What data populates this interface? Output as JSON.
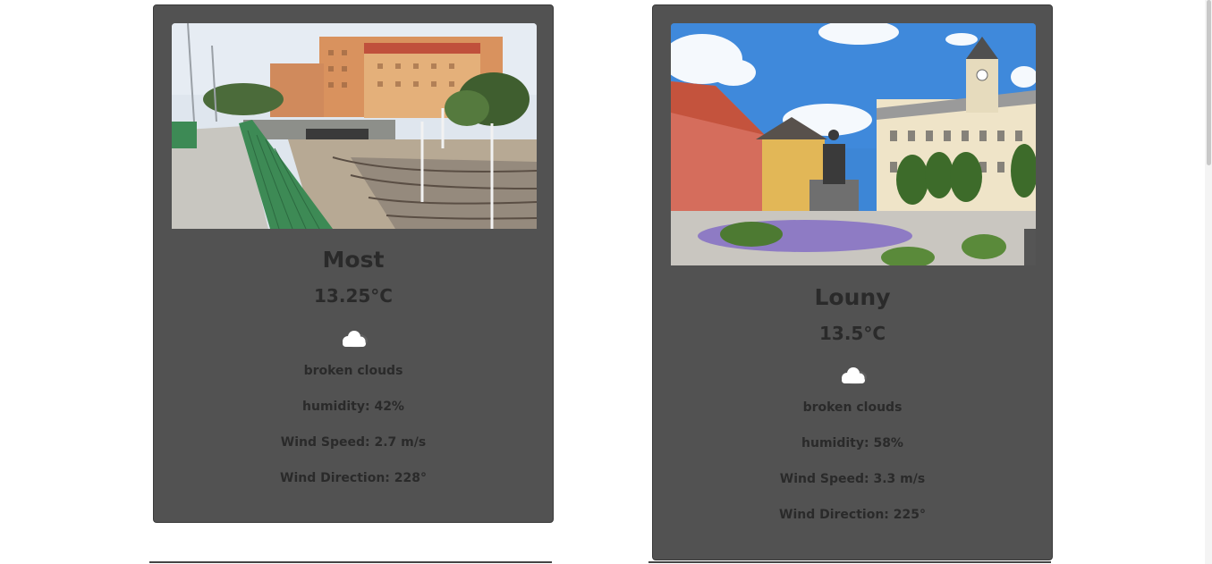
{
  "cards": [
    {
      "city": "Most",
      "temperature": "13.25°C",
      "weather_icon": "cloud-icon",
      "description": "broken clouds",
      "humidity": "humidity: 42%",
      "wind_speed": "Wind Speed: 2.7 m/s",
      "wind_direction": "Wind Direction: 228°"
    },
    {
      "city": "Louny",
      "temperature": "13.5°C",
      "weather_icon": "cloud-icon",
      "description": "broken clouds",
      "humidity": "humidity: 58%",
      "wind_speed": "Wind Speed: 3.3 m/s",
      "wind_direction": "Wind Direction: 225°"
    }
  ],
  "colors": {
    "card_background": "#525252",
    "text": "#2a2a2a",
    "page_background": "#ffffff"
  }
}
